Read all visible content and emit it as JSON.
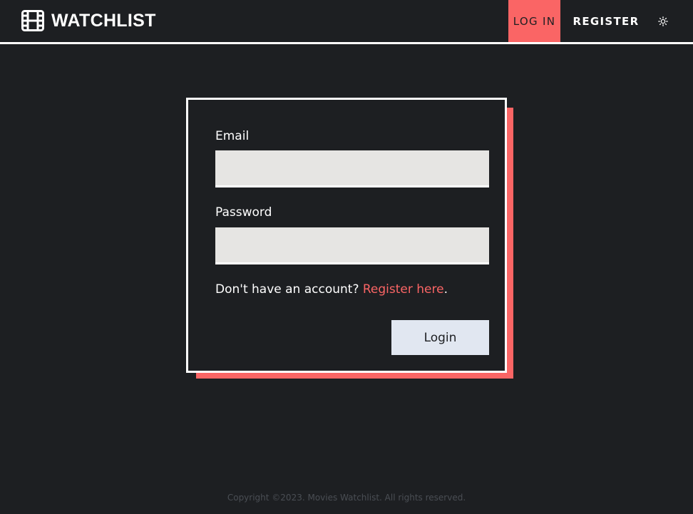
{
  "header": {
    "logo_text": "WATCHLIST",
    "logo_icon": "film-icon",
    "nav": {
      "login_label": "LOG IN",
      "register_label": "REGISTER",
      "theme_icon": "sun-icon"
    }
  },
  "form": {
    "email_label": "Email",
    "email_value": "",
    "password_label": "Password",
    "password_value": "",
    "register_prompt": "Don't have an account? ",
    "register_link": "Register here",
    "register_suffix": ".",
    "submit_label": "Login"
  },
  "footer": {
    "copyright": "Copyright ©2023. Movies Watchlist. All rights reserved."
  },
  "colors": {
    "background": "#1d1f22",
    "accent": "#fa6565",
    "input_bg": "#e6e5e3",
    "button_bg": "#e1e7f1",
    "text": "#ffffff"
  }
}
